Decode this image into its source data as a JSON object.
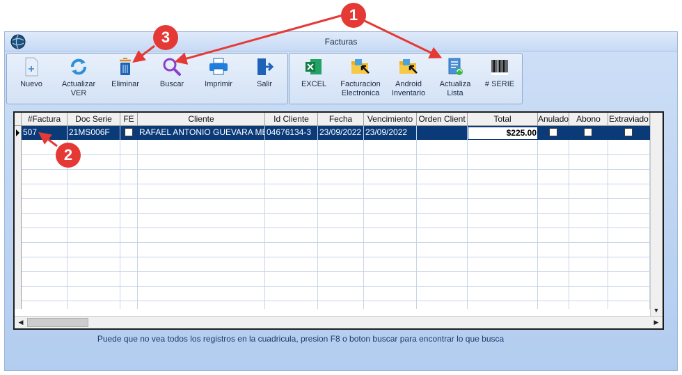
{
  "window": {
    "title": "Facturas"
  },
  "toolbar_main": [
    {
      "label": "Nuevo",
      "icon": "new-document-icon"
    },
    {
      "label": "Actualizar\nVER",
      "icon": "refresh-icon"
    },
    {
      "label": "Eliminar",
      "icon": "trash-icon"
    },
    {
      "label": "Buscar",
      "icon": "search-icon"
    },
    {
      "label": "Imprimir",
      "icon": "printer-icon"
    },
    {
      "label": "Salir",
      "icon": "exit-icon"
    }
  ],
  "toolbar_extra": [
    {
      "label": "EXCEL",
      "icon": "excel-icon"
    },
    {
      "label": "Facturacion\nElectronica",
      "icon": "folder-arrow-icon"
    },
    {
      "label": "Android\nInventario",
      "icon": "folder-arrow-icon"
    },
    {
      "label": "Actualiza\nLista",
      "icon": "list-refresh-icon"
    },
    {
      "label": "# SERIE",
      "icon": "barcode-icon"
    }
  ],
  "grid": {
    "columns": [
      "#Factura",
      "Doc Serie",
      "FE",
      "Cliente",
      "Id Cliente",
      "Fecha",
      "Vencimiento",
      "Orden Client",
      "Total",
      "Anulado",
      "Abono",
      "Extraviado"
    ],
    "rows": [
      {
        "factura": "507",
        "doc_serie": "21MS006F",
        "cliente": "RAFAEL ANTONIO GUEVARA ME",
        "id_cliente": "04676134-3",
        "fecha": "23/09/2022",
        "vencimiento": "23/09/2022",
        "orden_cliente": "",
        "total": "$225.00"
      }
    ]
  },
  "hint": "Puede que no vea todos los registros en la cuadricula, presion F8 o boton buscar para encontrar lo que busca",
  "annotations": [
    "1",
    "2",
    "3"
  ],
  "colors": {
    "selected_row": "#0b3a78",
    "badge": "#e53935",
    "window_bg": "#bcd3f2"
  }
}
